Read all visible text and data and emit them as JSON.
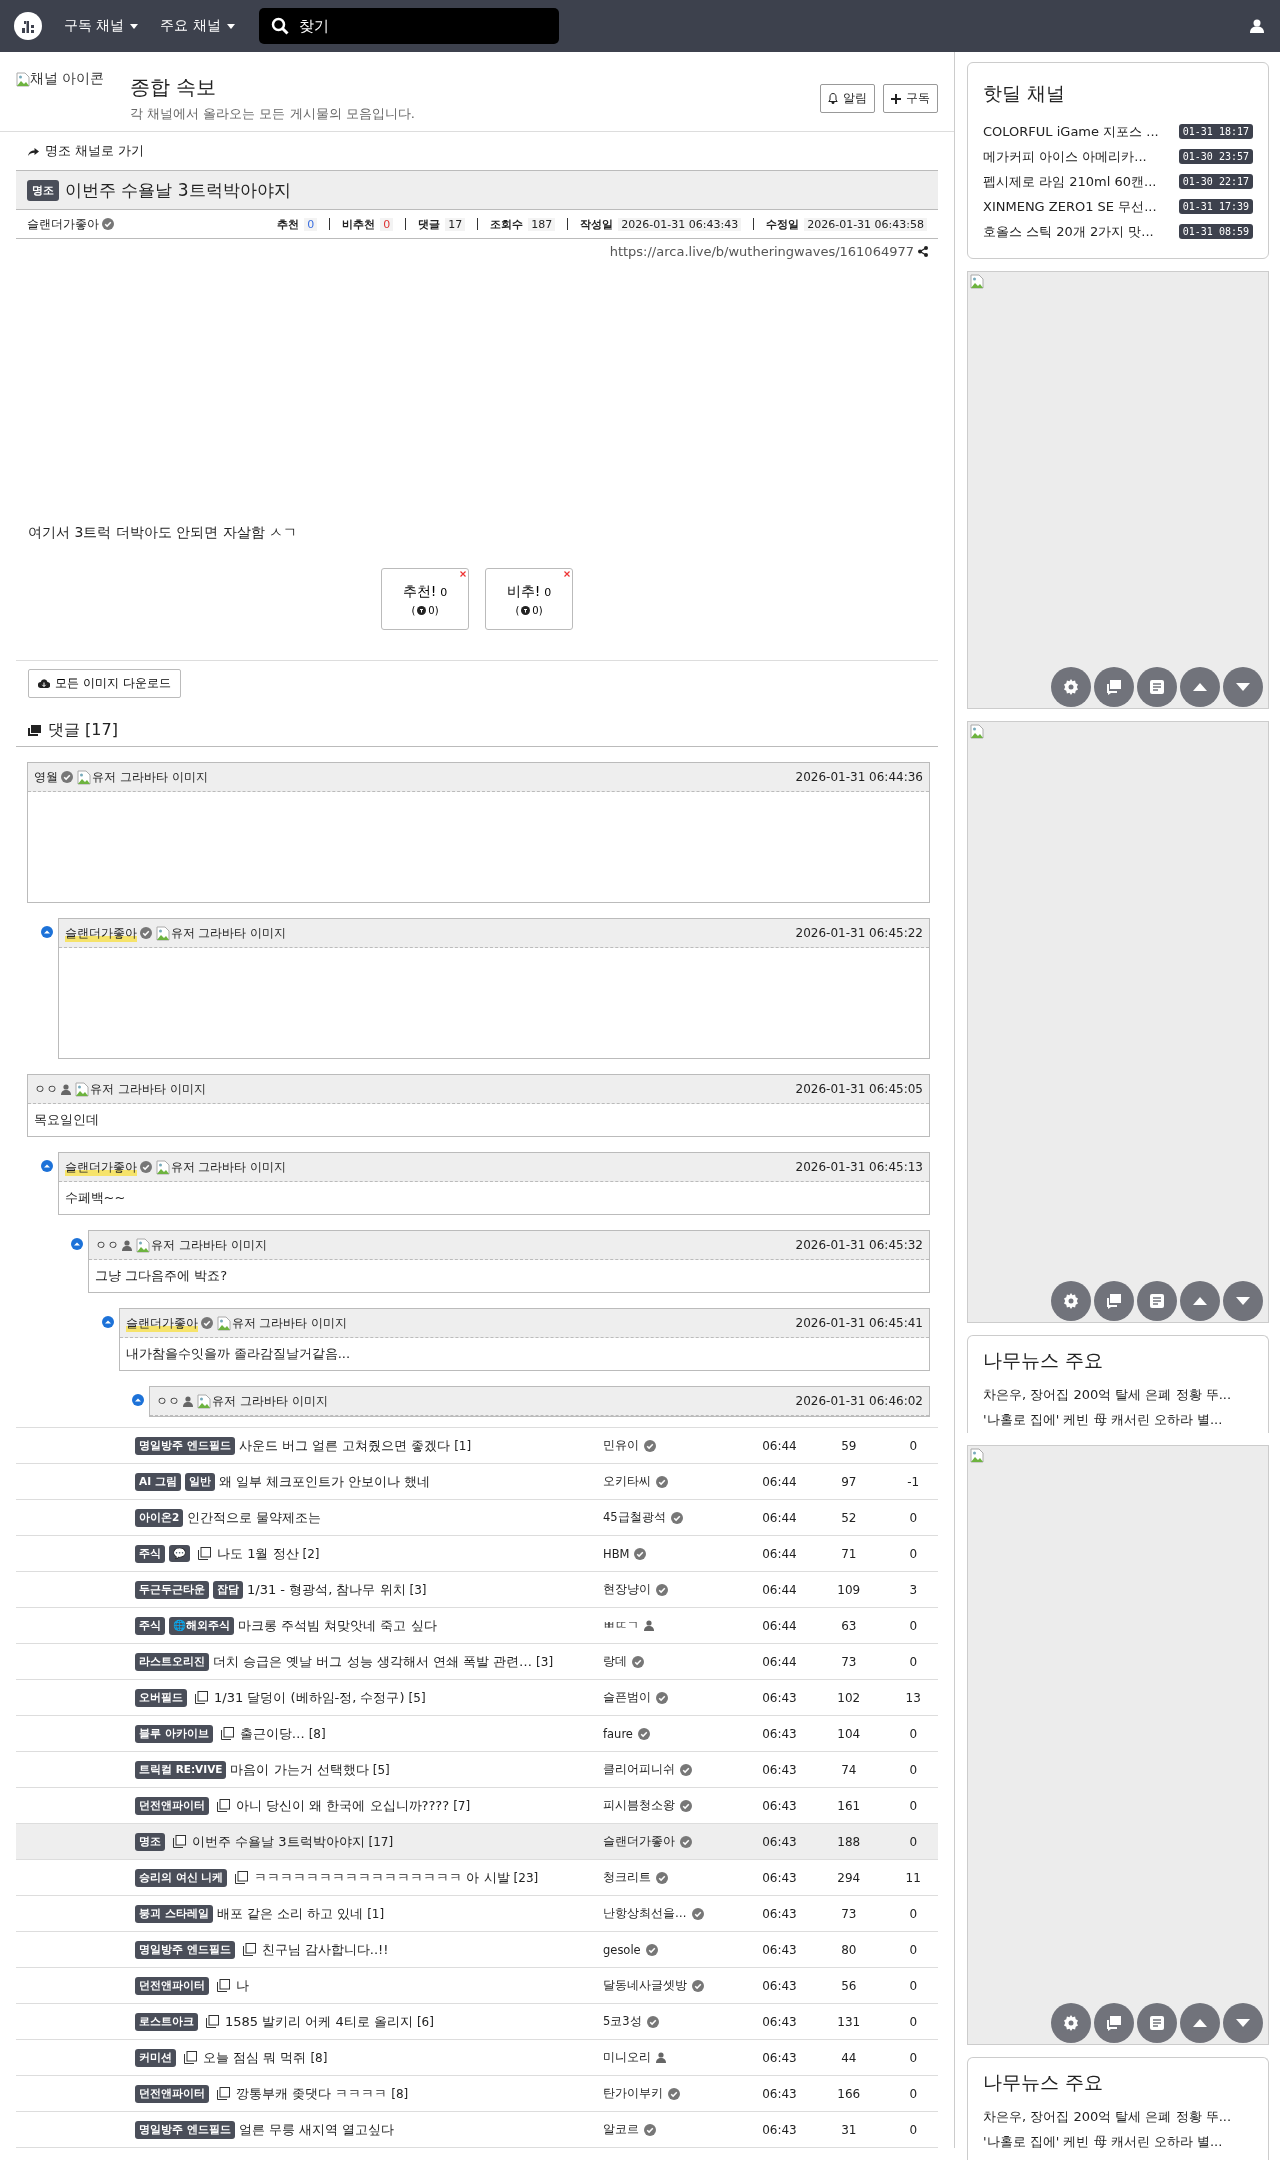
{
  "topbar": {
    "menus": [
      {
        "label": "구독 채널"
      },
      {
        "label": "주요 채널"
      }
    ],
    "search": {
      "placeholder": "찾기"
    }
  },
  "board": {
    "icon_alt": "채널 아이콘",
    "title": "종합 속보",
    "description": "각 채널에서 올라오는 모든 게시물의 모음입니다.",
    "buttons": [
      {
        "kind": "bell",
        "label": "알림"
      },
      {
        "kind": "plus",
        "label": "구독"
      }
    ]
  },
  "post": {
    "channel_link": "명조 채널로 가기",
    "badge": "명조",
    "title": "이번주 수욜날 3트럭박아야지",
    "author": "슬랜더가좋아",
    "stats": [
      {
        "label": "추천",
        "value": "0",
        "kind": "up"
      },
      {
        "label": "비추천",
        "value": "0",
        "kind": "down"
      },
      {
        "label": "댓글",
        "value": "17",
        "kind": "plain"
      },
      {
        "label": "조회수",
        "value": "187",
        "kind": "plain"
      },
      {
        "label": "작성일",
        "value": "2026-01-31 06:43:43",
        "kind": "plain"
      },
      {
        "label": "수정일",
        "value": "2026-01-31 06:43:58",
        "kind": "plain"
      }
    ],
    "url": "https://arca.live/b/wutheringwaves/161064977",
    "body": "여기서 3트럭 더박아도 안되면 자살함 ㅅㄱ",
    "votes": [
      {
        "label": "추천!",
        "count": "0",
        "sub_open": "(",
        "sub_count": "0)"
      },
      {
        "label": "비추!",
        "count": "0",
        "sub_open": "(",
        "sub_count": "0)"
      }
    ],
    "download_button": "모든 이미지 다운로드"
  },
  "comments": {
    "title": "댓글 [17]",
    "items": [
      {
        "author": "영월",
        "verified": true,
        "is_op": false,
        "avatar_alt": "유저 그라바타 이미지",
        "date": "2026-01-31 06:44:36",
        "kind": "blank",
        "children": [
          {
            "author": "슬랜더가좋아",
            "verified": true,
            "is_op": true,
            "avatar_alt": "유저 그라바타 이미지",
            "date": "2026-01-31 06:45:22",
            "kind": "blank"
          }
        ]
      },
      {
        "author": "ㅇㅇ",
        "verified": false,
        "is_op": false,
        "avatar_alt": "유저 그라바타 이미지",
        "date": "2026-01-31 06:45:05",
        "kind": "text",
        "body": "목요일인데",
        "children": [
          {
            "author": "슬랜더가좋아",
            "verified": true,
            "is_op": true,
            "avatar_alt": "유저 그라바타 이미지",
            "date": "2026-01-31 06:45:13",
            "kind": "text",
            "body": "수페백~~",
            "children": [
              {
                "author": "ㅇㅇ",
                "verified": false,
                "is_op": false,
                "avatar_alt": "유저 그라바타 이미지",
                "date": "2026-01-31 06:45:32",
                "kind": "text",
                "body": "그냥 그다음주에 박죠?",
                "children": [
                  {
                    "author": "슬랜더가좋아",
                    "verified": true,
                    "is_op": true,
                    "avatar_alt": "유저 그라바타 이미지",
                    "date": "2026-01-31 06:45:41",
                    "kind": "text",
                    "body": "내가참을수잇을까 졸라감질날거같음...",
                    "children": [
                      {
                        "author": "ㅇㅇ",
                        "verified": false,
                        "is_op": false,
                        "avatar_alt": "유저 그라바타 이미지",
                        "date": "2026-01-31 06:46:02"
                      }
                    ]
                  }
                ]
              }
            ]
          }
        ]
      }
    ]
  },
  "articles": [
    {
      "badges": [
        "명일방주 엔드필드"
      ],
      "has_image": false,
      "title": "사운드 버그 얼른 고쳐줬으면 좋겠다",
      "comment_count": "[1]",
      "author": "민유이",
      "verified": true,
      "time": "06:44",
      "views": "59",
      "rating": "0",
      "selected": false
    },
    {
      "badges": [
        "AI 그림",
        "일반"
      ],
      "has_image": false,
      "title": "왜 일부 체크포인트가 안보이나 했네",
      "author": "오키타씨",
      "verified": true,
      "time": "06:44",
      "views": "97",
      "rating": "-1",
      "selected": false
    },
    {
      "badges": [
        "아이온2"
      ],
      "has_image": false,
      "title": "인간적으로 물약제조는",
      "author": "45급철광석",
      "verified": true,
      "time": "06:44",
      "views": "52",
      "rating": "0",
      "selected": false
    },
    {
      "badges": [
        "주식",
        "💬"
      ],
      "has_image": true,
      "title": "나도 1월 정산",
      "comment_count": "[2]",
      "author": "HBM",
      "verified": true,
      "time": "06:44",
      "views": "71",
      "rating": "0",
      "selected": false
    },
    {
      "badges": [
        "두근두근타운",
        "잡담"
      ],
      "has_image": false,
      "title": "1/31 - 형광석, 참나무 위치",
      "comment_count": "[3]",
      "author": "현장냥이",
      "verified": true,
      "time": "06:44",
      "views": "109",
      "rating": "3",
      "selected": false
    },
    {
      "badges": [
        "주식",
        "🌐해외주식"
      ],
      "has_image": false,
      "title": "마크롱 주석빔 쳐맞앗네 죽고 싶다",
      "author": "ㅃㄸㄱ",
      "verified": false,
      "time": "06:44",
      "views": "63",
      "rating": "0",
      "selected": false
    },
    {
      "badges": [
        "라스트오리진"
      ],
      "has_image": false,
      "title": "더치 승급은 옛날 버그 성능 생각해서 연쇄 폭발 관련…",
      "comment_count": "[3]",
      "author": "랑데",
      "verified": true,
      "time": "06:44",
      "views": "73",
      "rating": "0",
      "selected": false
    },
    {
      "badges": [
        "오버필드"
      ],
      "has_image": true,
      "title": "1/31 달덩이 (베하임-정, 수정구)",
      "comment_count": "[5]",
      "author": "슬픈범이",
      "verified": true,
      "time": "06:43",
      "views": "102",
      "rating": "13",
      "selected": false
    },
    {
      "badges": [
        "블루 아카이브"
      ],
      "has_image": true,
      "title": "출근이당…",
      "comment_count": "[8]",
      "author": "faure",
      "verified": true,
      "time": "06:43",
      "views": "104",
      "rating": "0",
      "selected": false
    },
    {
      "badges": [
        "트릭컬 RE:VIVE"
      ],
      "has_image": false,
      "title": "마음이 가는거 선택했다",
      "comment_count": "[5]",
      "author": "클리어피니쉬",
      "verified": true,
      "time": "06:43",
      "views": "74",
      "rating": "0",
      "selected": false
    },
    {
      "badges": [
        "던전앤파이터"
      ],
      "has_image": true,
      "title": "아니 당신이 왜 한국에 오십니까????",
      "comment_count": "[7]",
      "author": "피시븜청소왕",
      "verified": true,
      "time": "06:43",
      "views": "161",
      "rating": "0",
      "selected": false
    },
    {
      "badges": [
        "명조"
      ],
      "has_image": true,
      "title": "이번주 수욜날 3트럭박아야지",
      "comment_count": "[17]",
      "author": "슬랜더가좋아",
      "verified": true,
      "time": "06:43",
      "views": "188",
      "rating": "0",
      "selected": true
    },
    {
      "badges": [
        "승리의 여신 니케"
      ],
      "has_image": true,
      "title": "ㅋㅋㅋㅋㅋㅋㅋㅋㅋㅋㅋㅋㅋㅋㅋㅋ 아 시발",
      "comment_count": "[23]",
      "author": "청크리트",
      "verified": true,
      "time": "06:43",
      "views": "294",
      "rating": "11",
      "selected": false
    },
    {
      "badges": [
        "붕괴 스타레일"
      ],
      "has_image": false,
      "title": "배포 같은 소리 하고 있네",
      "comment_count": "[1]",
      "author": "난항상최선을…",
      "verified": true,
      "time": "06:43",
      "views": "73",
      "rating": "0",
      "selected": false
    },
    {
      "badges": [
        "명일방주 엔드필드"
      ],
      "has_image": true,
      "title": "친구님 감사합니다..!!",
      "author": "gesole",
      "verified": true,
      "time": "06:43",
      "views": "80",
      "rating": "0",
      "selected": false
    },
    {
      "badges": [
        "던전앤파이터"
      ],
      "has_image": true,
      "title": "나",
      "author": "달동네사글셋방",
      "verified": true,
      "time": "06:43",
      "views": "56",
      "rating": "0",
      "selected": false
    },
    {
      "badges": [
        "로스트아크"
      ],
      "has_image": true,
      "title": "1585 발키리 어케 4티로 올리지",
      "comment_count": "[6]",
      "author": "5코3성",
      "verified": true,
      "time": "06:43",
      "views": "131",
      "rating": "0",
      "selected": false
    },
    {
      "badges": [
        "커미션"
      ],
      "has_image": true,
      "title": "오늘 점심 뭐 먹쥐",
      "comment_count": "[8]",
      "author": "미니오리",
      "verified": false,
      "time": "06:43",
      "views": "44",
      "rating": "0",
      "selected": false
    },
    {
      "badges": [
        "던전앤파이터"
      ],
      "has_image": true,
      "title": "깡통부캐 좆댓다 ㅋㅋㅋㅋ",
      "comment_count": "[8]",
      "author": "탄가이부키",
      "verified": true,
      "time": "06:43",
      "views": "166",
      "rating": "0",
      "selected": false
    },
    {
      "badges": [
        "명일방주 엔드필드"
      ],
      "has_image": false,
      "title": "얼른 무릉 새지역 열고싶다",
      "author": "알코르",
      "verified": true,
      "time": "06:43",
      "views": "31",
      "rating": "0",
      "selected": false
    }
  ],
  "sidebar": [
    {
      "kind": "hotdeal",
      "title": "핫딜 채널",
      "items": [
        {
          "text": "COLORFUL iGame 지포스 ...",
          "time": "01-31 18:17"
        },
        {
          "text": "메가커피 아이스 아메리카...",
          "time": "01-30 23:57"
        },
        {
          "text": "펩시제로 라임 210ml 60캔...",
          "time": "01-30 22:17"
        },
        {
          "text": "XINMENG ZERO1 SE 무선...",
          "time": "01-31 17:39"
        },
        {
          "text": "호올스 스틱 20개 2가지 맛...",
          "time": "01-31 08:59"
        }
      ]
    },
    {
      "kind": "image",
      "toolbar": true
    },
    {
      "kind": "image",
      "toolbar": true
    },
    {
      "kind": "news",
      "title": "나무뉴스 주요",
      "items": [
        {
          "text": "차은우, 장어집 200억 탈세 은폐 정황 뚜..."
        },
        {
          "text": "'나홀로 집에' 케빈 母 캐서린 오하라 별..."
        }
      ]
    },
    {
      "kind": "image",
      "toolbar": true
    },
    {
      "kind": "news",
      "title": "나무뉴스 주요",
      "items": [
        {
          "text": "차은우, 장어집 200억 탈세 은폐 정황 뚜..."
        },
        {
          "text": "'나홀로 집에' 케빈 母 캐서린 오하라 별..."
        }
      ]
    }
  ]
}
